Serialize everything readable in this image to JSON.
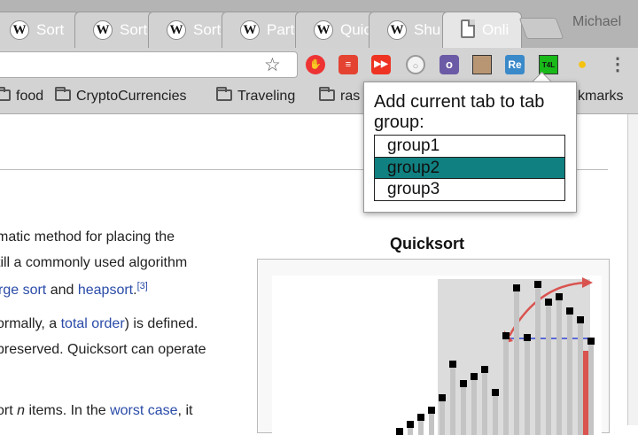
{
  "browser": {
    "tabs": [
      {
        "label": "Sort",
        "icon": "wikipedia-icon"
      },
      {
        "label": "Sort",
        "icon": "wikipedia-icon"
      },
      {
        "label": "Sort",
        "icon": "wikipedia-icon"
      },
      {
        "label": "Part",
        "icon": "wikipedia-icon"
      },
      {
        "label": "Quic",
        "icon": "wikipedia-icon"
      },
      {
        "label": "Shu",
        "icon": "wikipedia-icon"
      },
      {
        "label": "Onli",
        "icon": "document-icon"
      }
    ],
    "profile_name": "Michael",
    "bookmarks": [
      {
        "label": "food"
      },
      {
        "label": "CryptoCurrencies"
      },
      {
        "label": "Traveling"
      },
      {
        "label": "ras"
      },
      {
        "label": "kmarks"
      }
    ]
  },
  "article": {
    "lines": [
      {
        "text": "matic method for placing the"
      },
      {
        "text": "till a commonly used algorithm"
      },
      {
        "link1": "rge sort",
        "mid": " and ",
        "link2": "heapsort",
        "end": ".",
        "sup": "[3]"
      },
      {
        "pre": "ormally, a ",
        "link": "total order",
        "post": ") is defined."
      },
      {
        "text": "preserved. Quicksort can operate"
      },
      {
        "pre": "ort ",
        "italic": "n",
        "mid": " items. In the ",
        "link": "worst case",
        "post": ", it"
      }
    ],
    "infobox_title": "Quicksort"
  },
  "popup": {
    "title": "Add current tab to tab group:",
    "groups": [
      "group1",
      "group2",
      "group3"
    ],
    "selected": "group2",
    "accent_color": "#118080"
  }
}
